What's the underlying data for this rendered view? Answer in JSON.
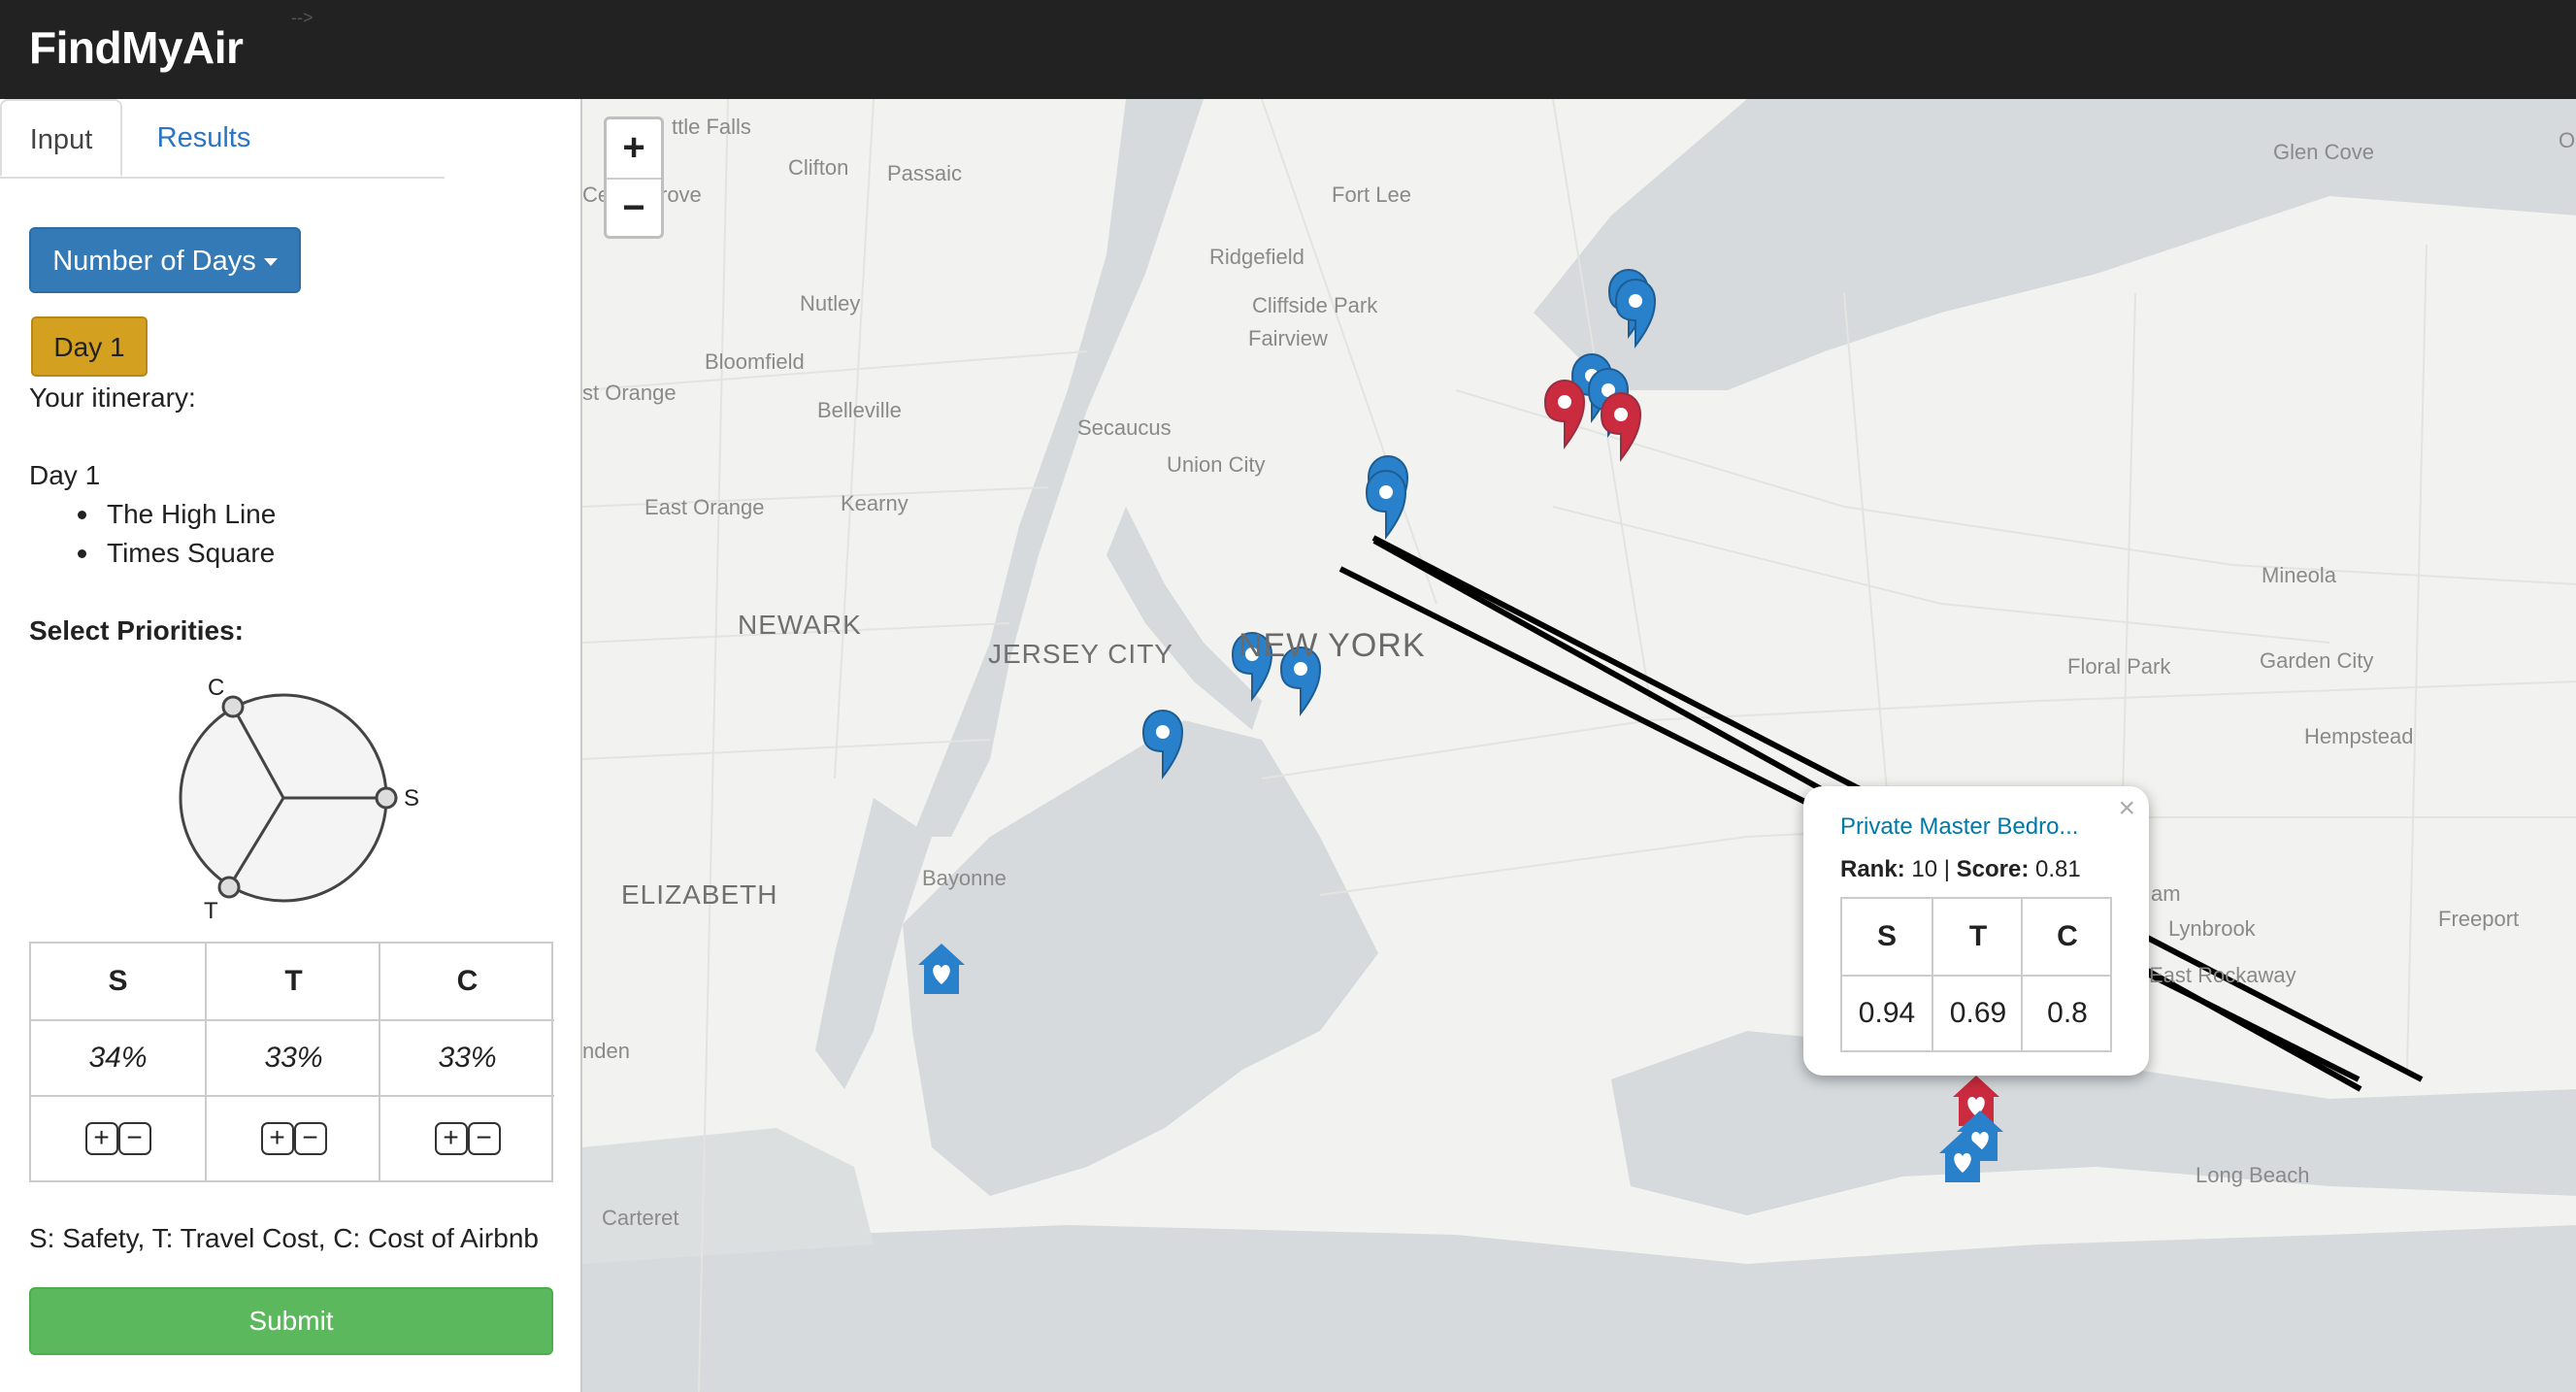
{
  "app": {
    "title": "FindMyAir",
    "header_comment": "-->"
  },
  "tabs": [
    {
      "label": "Input"
    },
    {
      "label": "Results"
    }
  ],
  "input": {
    "days_button": "Number of Days",
    "day_badge": "Day 1",
    "itinerary_heading": "Your itinerary:",
    "itinerary_day": "Day 1",
    "itinerary_items": [
      "The High Line",
      "Times Square"
    ],
    "priorities_heading": "Select Priorities:",
    "priority_wheel": {
      "labels": [
        "C",
        "S",
        "T"
      ]
    },
    "priority_table": {
      "headers": [
        "S",
        "T",
        "C"
      ],
      "values": [
        "34%",
        "33%",
        "33%"
      ],
      "plus": "+",
      "minus": "−"
    },
    "legend_note": "S: Safety, T: Travel Cost, C: Cost of Airbnb",
    "submit_label": "Submit"
  },
  "map": {
    "zoom_in": "+",
    "zoom_out": "−",
    "labels": [
      "ttle Falls",
      "Clifton",
      "Passaic",
      "Fort Lee",
      "Glen Cove",
      "Ridgefield",
      "Nutley",
      "Cliffside Park",
      "Fairview",
      "Bloomfield",
      "st Orange",
      "Belleville",
      "Secaucus",
      "Union City",
      "East Orange",
      "Kearny",
      "NEWARK",
      "JERSEY CITY",
      "NEW YORK",
      "Mineola",
      "Garden City",
      "Floral Park",
      "Hempstead",
      "Bayonne",
      "ELIZABETH",
      "Freeport",
      "Lynbrook",
      "East Rockaway",
      "Long Beach",
      "nden",
      "Carteret",
      "am",
      "Ce",
      "rove",
      "O"
    ],
    "colors": {
      "blue_marker": "#2a81cb",
      "red_marker": "#cb2b3e",
      "route": "#000000",
      "water": "#d6dadc",
      "land": "#f2f2f0"
    },
    "marker_icons": [
      "map-pin-icon",
      "home-heart-icon"
    ]
  },
  "popup": {
    "title": "Private Master Bedro...",
    "rank_label": "Rank:",
    "rank_value": "10",
    "separator": "|",
    "score_label": "Score:",
    "score_value": "0.81",
    "close": "×",
    "headers": [
      "S",
      "T",
      "C"
    ],
    "values": [
      "0.94",
      "0.69",
      "0.8"
    ]
  }
}
